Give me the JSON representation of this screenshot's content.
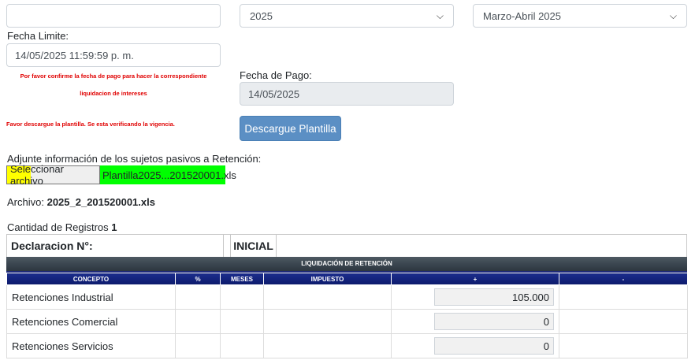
{
  "top": {
    "empty_field_value": "",
    "year_select": "2025",
    "period_select": "Marzo-Abril 2025"
  },
  "fecha_limite": {
    "label": "Fecha Limite:",
    "value": "14/05/2025 11:59:59 p. m."
  },
  "warning_confirm": {
    "line1": "Por favor confirme la fecha de pago para hacer la correspondiente",
    "line2": "liquidacion de intereses"
  },
  "fecha_pago": {
    "label": "Fecha de Pago:",
    "value": "14/05/2025"
  },
  "warning_template": "Favor descargue la plantilla. Se esta verificando la vigencia.",
  "download_button": "Descargue Plantilla",
  "attach": {
    "label": "Adjunte información de los sujetos pasivos a Retención:",
    "button_label": "Seleccionar archivo",
    "selected_file": "Plantilla2025...201520001.xls",
    "highlight_color": "#ffff00",
    "file_highlight_color": "#00ff00"
  },
  "archivo": {
    "label": "Archivo:",
    "value": "2025_2_201520001.xls"
  },
  "registros": {
    "label": "Cantidad de Registros",
    "value": "1"
  },
  "declaracion": {
    "label": "Declaracion N°:",
    "value": "",
    "tipo": "INICIAL",
    "extra": ""
  },
  "liquidacion": {
    "title": "LIQUIDACIÓN DE RETENCIÓN",
    "columns": [
      "CONCEPTO",
      "%",
      "MESES",
      "IMPUESTO",
      "+",
      "-"
    ],
    "rows": [
      {
        "concepto": "Retenciones Industrial",
        "valor": "105.000"
      },
      {
        "concepto": "Retenciones Comercial",
        "valor": "0"
      },
      {
        "concepto": "Retenciones Servicios",
        "valor": "0"
      }
    ]
  },
  "colors": {
    "button": "#5b8fc4",
    "warning_text": "#e00000",
    "header_dark": "#3b4650",
    "header_blue": "#0c1a6c"
  }
}
